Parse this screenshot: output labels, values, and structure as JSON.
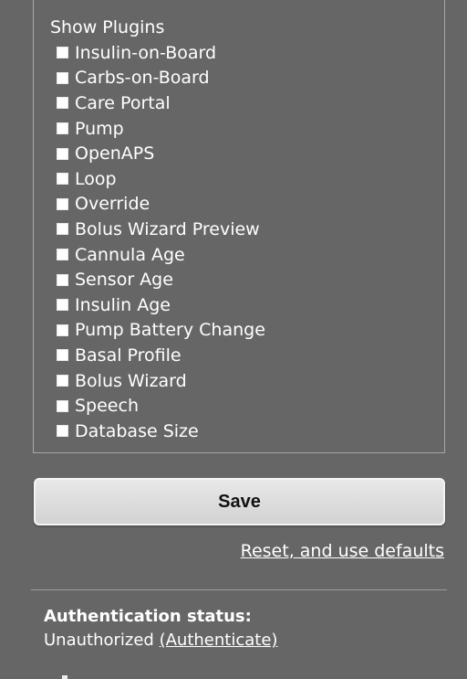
{
  "plugins": {
    "title": "Show Plugins",
    "items": [
      {
        "label": "Insulin-on-Board"
      },
      {
        "label": "Carbs-on-Board"
      },
      {
        "label": "Care Portal"
      },
      {
        "label": "Pump"
      },
      {
        "label": "OpenAPS"
      },
      {
        "label": "Loop"
      },
      {
        "label": "Override"
      },
      {
        "label": "Bolus Wizard Preview"
      },
      {
        "label": "Cannula Age"
      },
      {
        "label": "Sensor Age"
      },
      {
        "label": "Insulin Age"
      },
      {
        "label": "Pump Battery Change"
      },
      {
        "label": "Basal Profile"
      },
      {
        "label": "Bolus Wizard"
      },
      {
        "label": "Speech"
      },
      {
        "label": "Database Size"
      }
    ]
  },
  "actions": {
    "save_label": "Save",
    "reset_label": "Reset, and use defaults"
  },
  "auth": {
    "heading": "Authentication status:",
    "status": "Unauthorized",
    "link_label": "(Authenticate)"
  },
  "colors": {
    "background": "#666666",
    "text": "#ffffff",
    "button": "#dcdcdc"
  }
}
